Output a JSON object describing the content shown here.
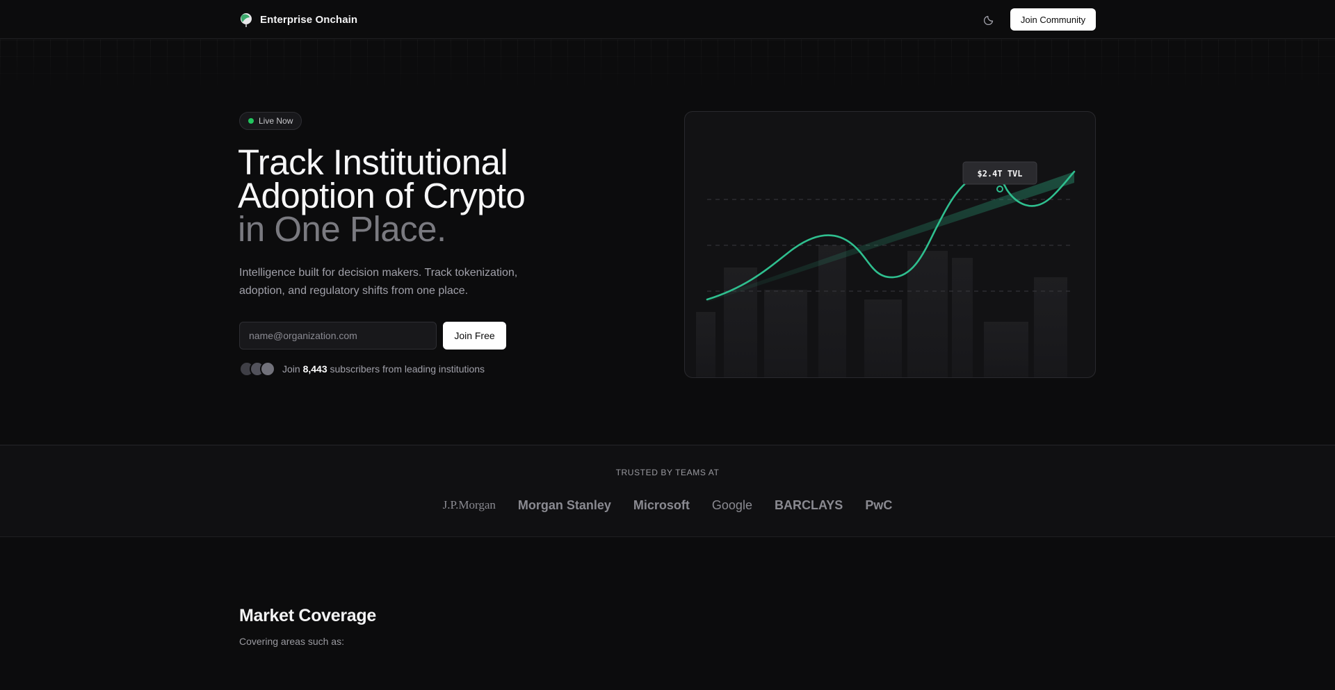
{
  "header": {
    "brand": "Enterprise Onchain",
    "join_community_label": "Join Community",
    "logo_icon": "leaf-globe-logo",
    "theme_icon": "moon-icon"
  },
  "hero": {
    "badge": "Live Now",
    "badge_color": "#22c55e",
    "title_lines": [
      "Track Institutional",
      "Adoption of Crypto",
      "in One Place."
    ],
    "subtitle": "Intelligence built for decision makers. Track tokenization, adoption, and regulatory shifts from one place.",
    "email_placeholder": "name@organization.com",
    "join_free_label": "Join Free",
    "subscribers": {
      "prefix": "Join",
      "count": "8,443",
      "suffix": "subscribers from leading institutions"
    }
  },
  "chart": {
    "tooltip": "$2.4T TVL",
    "accent": "#2fbf8f"
  },
  "trusted": {
    "label": "TRUSTED BY TEAMS AT",
    "logos": [
      "J.P.Morgan",
      "Morgan Stanley",
      "Microsoft",
      "Google",
      "BARCLAYS",
      "PwC"
    ]
  },
  "market_coverage": {
    "title": "Market Coverage",
    "subtitle": "Covering areas such as:"
  }
}
